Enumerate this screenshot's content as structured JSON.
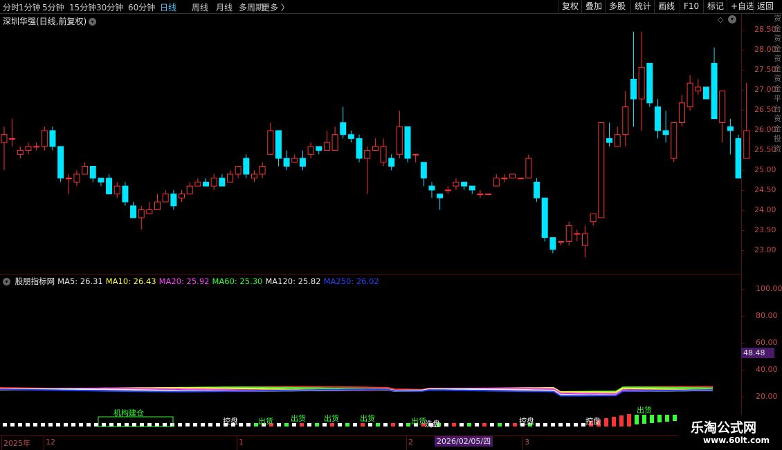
{
  "toolbar": {
    "left_items": [
      "分时",
      "1分钟",
      "5分钟",
      "15分钟",
      "30分钟",
      "60分钟",
      "日线",
      "周线",
      "月线",
      "多周期",
      "更多 〉"
    ],
    "active_item": "日线",
    "right_items": [
      "复权",
      "叠加",
      "多股",
      "统计",
      "画线",
      "F10",
      "标记",
      "+自选",
      "返回"
    ]
  },
  "main_title": "深圳华强(日线,前复权)",
  "price_axis": {
    "ticks": [
      "28.50",
      "28.00",
      "27.50",
      "27.00",
      "26.50",
      "26.00",
      "25.50",
      "25.00",
      "24.50",
      "24.00",
      "23.50",
      "23.00"
    ]
  },
  "sub_legend": [
    {
      "label": "股朋指标网",
      "color": "#e8e8e8"
    },
    {
      "label": "MA5: 26.31",
      "color": "#e8e8e8"
    },
    {
      "label": "MA10: 26.43",
      "color": "#ffff33"
    },
    {
      "label": "MA20: 25.92",
      "color": "#ff44ff"
    },
    {
      "label": "MA60: 25.30",
      "color": "#33ff33"
    },
    {
      "label": "MA120: 25.82",
      "color": "#e8e8e8"
    },
    {
      "label": "MA250: 26.02",
      "color": "#2244ff"
    }
  ],
  "sub_axis": {
    "ticks": [
      "100.00",
      "80.00",
      "60.00",
      "40.00",
      "20.00"
    ]
  },
  "sub_value_badge": "48.48",
  "signals": {
    "labels": [
      "机构建仓",
      "控盘",
      "出货",
      "出货",
      "出货",
      "出货",
      "出货",
      "洗盘",
      "控盘",
      "控盘",
      "出货"
    ]
  },
  "date_axis": {
    "labels": [
      "2025年",
      "12",
      "1",
      "2",
      "3"
    ],
    "selected_date": "2026/02/05/四"
  },
  "right_strip_text": "资金资金资金资金平台资金投资",
  "watermark": {
    "title": "乐淘公式网",
    "url": "www.60lt.com"
  },
  "colors": {
    "up": "#ff3333",
    "down": "#00e5ff",
    "axis": "#c84a4a",
    "background": "#000000"
  },
  "chart_data": {
    "type": "candlestick",
    "y_range": [
      22.7,
      28.6
    ],
    "candles": [
      [
        25.7,
        25.9,
        25.0,
        26.1
      ],
      [
        25.8,
        25.8,
        25.6,
        26.3
      ],
      [
        25.4,
        25.5,
        25.3,
        25.6
      ],
      [
        25.5,
        25.6,
        25.4,
        25.7
      ],
      [
        25.6,
        25.6,
        25.5,
        25.7
      ],
      [
        25.6,
        26.0,
        25.5,
        26.1
      ],
      [
        26.0,
        25.6,
        25.5,
        26.1
      ],
      [
        25.6,
        24.8,
        24.7,
        25.6
      ],
      [
        24.8,
        24.8,
        24.4,
        24.9
      ],
      [
        24.7,
        24.9,
        24.6,
        25.0
      ],
      [
        24.9,
        25.1,
        24.9,
        25.2
      ],
      [
        25.1,
        24.8,
        24.7,
        25.1
      ],
      [
        24.8,
        24.7,
        24.6,
        24.8
      ],
      [
        24.8,
        24.4,
        24.4,
        24.9
      ],
      [
        24.4,
        24.6,
        24.3,
        24.7
      ],
      [
        24.6,
        24.2,
        24.1,
        24.7
      ],
      [
        24.1,
        23.8,
        23.8,
        24.2
      ],
      [
        23.8,
        24.0,
        23.5,
        24.1
      ],
      [
        23.9,
        24.0,
        23.9,
        24.2
      ],
      [
        24.0,
        24.2,
        24.0,
        24.4
      ],
      [
        24.2,
        24.4,
        24.2,
        24.5
      ],
      [
        24.4,
        24.1,
        24.0,
        24.5
      ],
      [
        24.3,
        24.4,
        24.2,
        24.5
      ],
      [
        24.4,
        24.6,
        24.4,
        24.7
      ],
      [
        24.6,
        24.7,
        24.6,
        24.8
      ],
      [
        24.7,
        24.6,
        24.6,
        24.8
      ],
      [
        24.6,
        24.8,
        24.5,
        24.9
      ],
      [
        24.8,
        24.6,
        24.6,
        24.9
      ],
      [
        24.7,
        24.9,
        24.7,
        25.0
      ],
      [
        24.9,
        25.1,
        24.8,
        25.1
      ],
      [
        25.3,
        24.9,
        24.8,
        25.4
      ],
      [
        24.8,
        24.9,
        24.7,
        25.0
      ],
      [
        24.9,
        25.1,
        24.8,
        25.2
      ],
      [
        25.4,
        26.0,
        25.4,
        26.2
      ],
      [
        26.0,
        25.3,
        25.1,
        26.0
      ],
      [
        25.3,
        25.1,
        25.0,
        25.5
      ],
      [
        25.2,
        25.3,
        25.2,
        25.4
      ],
      [
        25.3,
        25.1,
        25.0,
        25.5
      ],
      [
        25.4,
        25.6,
        25.3,
        25.7
      ],
      [
        25.6,
        25.5,
        25.4,
        25.6
      ],
      [
        25.5,
        25.7,
        25.5,
        26.0
      ],
      [
        25.5,
        25.9,
        25.5,
        26.1
      ],
      [
        26.2,
        25.9,
        25.8,
        26.6
      ],
      [
        25.9,
        25.8,
        25.7,
        26.0
      ],
      [
        25.8,
        25.3,
        25.2,
        25.9
      ],
      [
        25.3,
        25.5,
        24.4,
        25.6
      ],
      [
        25.5,
        25.6,
        25.5,
        25.8
      ],
      [
        25.2,
        25.6,
        25.1,
        25.8
      ],
      [
        25.3,
        25.1,
        25.0,
        25.4
      ],
      [
        25.4,
        26.1,
        25.3,
        26.5
      ],
      [
        26.1,
        25.3,
        25.2,
        26.1
      ],
      [
        25.4,
        25.4,
        25.2,
        25.4
      ],
      [
        25.2,
        24.8,
        24.6,
        25.2
      ],
      [
        24.6,
        24.5,
        24.3,
        24.7
      ],
      [
        24.4,
        24.3,
        24.0,
        24.4
      ],
      [
        24.5,
        24.5,
        24.4,
        24.6
      ],
      [
        24.6,
        24.7,
        24.5,
        24.8
      ],
      [
        24.7,
        24.6,
        24.5,
        24.7
      ],
      [
        24.6,
        24.5,
        24.4,
        24.6
      ],
      [
        24.4,
        24.4,
        24.3,
        24.5
      ],
      [
        24.4,
        24.4,
        24.4,
        24.4
      ],
      [
        24.6,
        24.8,
        24.6,
        24.9
      ],
      [
        24.8,
        24.8,
        24.7,
        24.9
      ],
      [
        24.8,
        24.9,
        24.8,
        24.9
      ],
      [
        24.8,
        24.8,
        24.8,
        24.8
      ],
      [
        24.8,
        25.3,
        24.8,
        25.4
      ],
      [
        24.7,
        24.3,
        24.2,
        24.8
      ],
      [
        24.3,
        23.3,
        23.2,
        24.3
      ],
      [
        23.3,
        23.0,
        22.9,
        23.0
      ],
      [
        23.2,
        23.2,
        23.1,
        23.2
      ],
      [
        23.2,
        23.6,
        23.1,
        23.7
      ],
      [
        23.4,
        23.4,
        23.2,
        23.5
      ],
      [
        23.1,
        23.4,
        22.8,
        23.6
      ],
      [
        23.7,
        23.9,
        23.6,
        23.9
      ],
      [
        23.8,
        26.2,
        23.8,
        26.2
      ],
      [
        25.8,
        25.7,
        25.6,
        26.2
      ],
      [
        25.6,
        25.9,
        25.6,
        26.1
      ],
      [
        25.9,
        26.6,
        25.6,
        27.0
      ],
      [
        27.3,
        26.8,
        26.1,
        28.5
      ],
      [
        26.8,
        27.6,
        26.0,
        28.5
      ],
      [
        27.7,
        26.7,
        26.6,
        27.7
      ],
      [
        26.6,
        26.0,
        25.8,
        26.8
      ],
      [
        26.0,
        25.9,
        25.7,
        26.5
      ],
      [
        25.3,
        26.2,
        25.2,
        26.2
      ],
      [
        26.2,
        26.7,
        26.1,
        26.9
      ],
      [
        26.6,
        27.2,
        26.5,
        27.4
      ],
      [
        27.0,
        27.1,
        26.9,
        27.3
      ],
      [
        27.1,
        26.8,
        26.8,
        27.1
      ],
      [
        27.7,
        26.3,
        26.3,
        28.1
      ],
      [
        26.2,
        27.0,
        25.7,
        27.0
      ],
      [
        26.1,
        26.0,
        25.4,
        26.3
      ],
      [
        25.8,
        24.8,
        24.8,
        25.9
      ],
      [
        25.3,
        26.0,
        25.3,
        27.2
      ]
    ]
  }
}
